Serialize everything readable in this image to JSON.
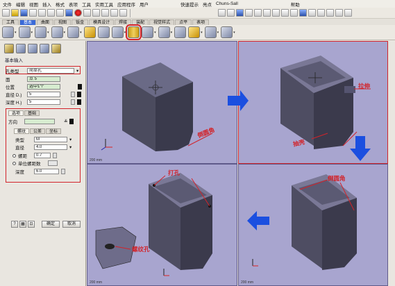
{
  "menu": {
    "items": [
      "文件",
      "编辑",
      "视图",
      "插入",
      "格式",
      "表项",
      "工具",
      "实用工具",
      "应用程序",
      "用户"
    ],
    "status_left": "快速提示",
    "status_mid": "亮点",
    "status_file": "Chuns-Sall",
    "help": "帮助"
  },
  "tabs": [
    "工具",
    "基本",
    "曲面",
    "视图",
    "钣金",
    "模具设计",
    "焊接",
    "装配",
    "视觉样式",
    "点平",
    "表项"
  ],
  "panel": {
    "section": "基本输入",
    "hole_type_label": "孔类型",
    "hole_type_value": "简单孔",
    "face_label": "面",
    "face_value": "点 5",
    "position_label": "位置",
    "position_value": "选中1个",
    "diameter_label": "直径 D.)",
    "diameter_value": "5",
    "depth_label": "深度 H.)",
    "depth_value": "5",
    "sub_tabs": [
      "选项",
      "基础"
    ],
    "direction_label": "方向",
    "inner_tabs": [
      "螺纹",
      "公差",
      "坐标"
    ],
    "type_label": "类型",
    "type_value": "M",
    "diam2_label": "直径",
    "diam2_value": "4.0",
    "pitch_label": "螺距",
    "pitch_value": "0.7",
    "per_inch_label": "单位螺距数",
    "thread_depth_label": "深度",
    "thread_depth_value": "6.0",
    "ok_label": "确定",
    "cancel_label": "取消"
  },
  "viewports": {
    "label": "200 mm",
    "annotations": {
      "fillet1": "倒圆角",
      "stretch": "拉伸",
      "shell": "抽壳",
      "hole": "打孔",
      "fillet2": "倒圆角",
      "thread": "螺纹孔"
    }
  },
  "colors": {
    "viewport_bg": "#a8a5cf",
    "annotation": "#d2232a",
    "arrow": "#1b4fe0",
    "part": "#3d3d4e"
  }
}
